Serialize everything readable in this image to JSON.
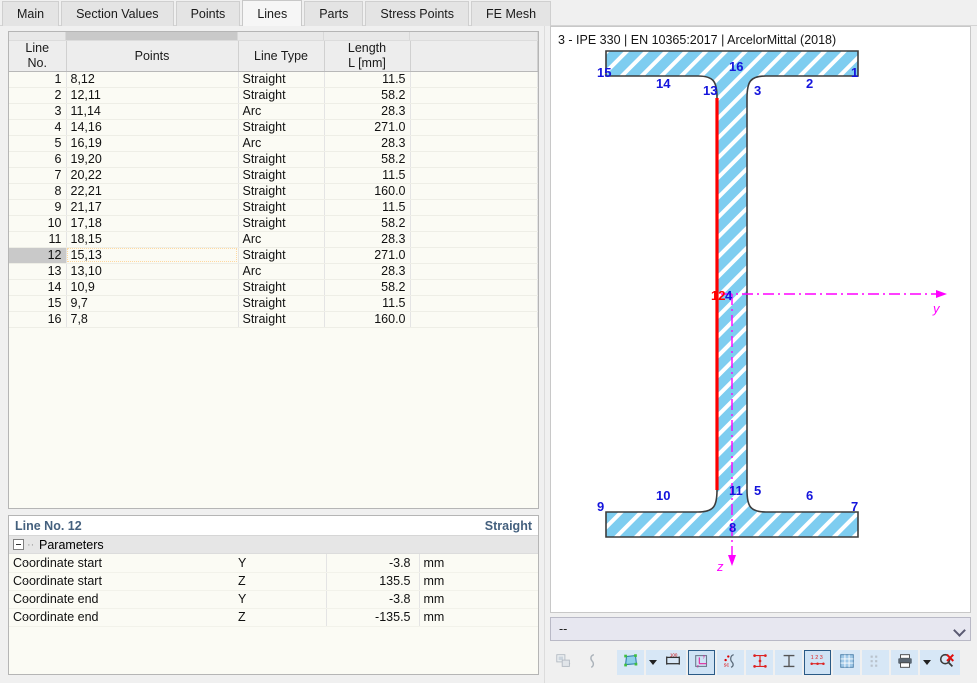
{
  "tabs": [
    {
      "label": "Main",
      "active": false
    },
    {
      "label": "Section Values",
      "active": false
    },
    {
      "label": "Points",
      "active": false
    },
    {
      "label": "Lines",
      "active": true
    },
    {
      "label": "Parts",
      "active": false
    },
    {
      "label": "Stress Points",
      "active": false
    },
    {
      "label": "FE Mesh",
      "active": false
    }
  ],
  "table": {
    "headers": {
      "line_no": "Line\nNo.",
      "line_no_l1": "Line",
      "line_no_l2": "No.",
      "points": "Points",
      "line_type": "Line Type",
      "length_l1": "Length",
      "length_l2": "L [mm]",
      "blank": ""
    },
    "rows": [
      {
        "no": "1",
        "points": "8,12",
        "type": "Straight",
        "length": "11.5",
        "selected": false
      },
      {
        "no": "2",
        "points": "12,11",
        "type": "Straight",
        "length": "58.2",
        "selected": false
      },
      {
        "no": "3",
        "points": "11,14",
        "type": "Arc",
        "length": "28.3",
        "selected": false
      },
      {
        "no": "4",
        "points": "14,16",
        "type": "Straight",
        "length": "271.0",
        "selected": false
      },
      {
        "no": "5",
        "points": "16,19",
        "type": "Arc",
        "length": "28.3",
        "selected": false
      },
      {
        "no": "6",
        "points": "19,20",
        "type": "Straight",
        "length": "58.2",
        "selected": false
      },
      {
        "no": "7",
        "points": "20,22",
        "type": "Straight",
        "length": "11.5",
        "selected": false
      },
      {
        "no": "8",
        "points": "22,21",
        "type": "Straight",
        "length": "160.0",
        "selected": false
      },
      {
        "no": "9",
        "points": "21,17",
        "type": "Straight",
        "length": "11.5",
        "selected": false
      },
      {
        "no": "10",
        "points": "17,18",
        "type": "Straight",
        "length": "58.2",
        "selected": false
      },
      {
        "no": "11",
        "points": "18,15",
        "type": "Arc",
        "length": "28.3",
        "selected": false
      },
      {
        "no": "12",
        "points": "15,13",
        "type": "Straight",
        "length": "271.0",
        "selected": true
      },
      {
        "no": "13",
        "points": "13,10",
        "type": "Arc",
        "length": "28.3",
        "selected": false
      },
      {
        "no": "14",
        "points": "10,9",
        "type": "Straight",
        "length": "58.2",
        "selected": false
      },
      {
        "no": "15",
        "points": "9,7",
        "type": "Straight",
        "length": "11.5",
        "selected": false
      },
      {
        "no": "16",
        "points": "7,8",
        "type": "Straight",
        "length": "160.0",
        "selected": false
      }
    ]
  },
  "parameters": {
    "header_left": "Line No. 12",
    "header_right": "Straight",
    "group_label": "Parameters",
    "rows": [
      {
        "name": "Coordinate start",
        "axis": "Y",
        "value": "-3.8",
        "unit": "mm"
      },
      {
        "name": "Coordinate start",
        "axis": "Z",
        "value": "135.5",
        "unit": "mm"
      },
      {
        "name": "Coordinate end",
        "axis": "Y",
        "value": "-3.8",
        "unit": "mm"
      },
      {
        "name": "Coordinate end",
        "axis": "Z",
        "value": "-135.5",
        "unit": "mm"
      }
    ]
  },
  "viewer": {
    "title": "3 - IPE 330 | EN 10365:2017 | ArcelorMittal (2018)",
    "point_labels": [
      "1",
      "2",
      "3",
      "5",
      "6",
      "7",
      "8",
      "9",
      "10",
      "11",
      "13",
      "14",
      "15",
      "16"
    ],
    "selected_line_label": "12",
    "centroid_label": "4",
    "axis_y_label": "y",
    "axis_z_label": "z",
    "colors": {
      "section_fill": "#7ecdf0",
      "section_outline": "#3c3c3c",
      "label_blue": "#1414dc",
      "selected_red": "#ff0000",
      "axis_magenta": "#ff00ff"
    },
    "combo_value": "--",
    "toolbar": [
      {
        "name": "import-section-button",
        "icon": "import",
        "state": "disabled"
      },
      {
        "name": "section-outline-button",
        "icon": "outline",
        "state": "disabled"
      },
      {
        "name": "show-parts-button",
        "icon": "part",
        "state": "lite"
      },
      {
        "name": "show-parts-dropdown",
        "icon": "caret",
        "state": "lite"
      },
      {
        "name": "show-dimensions-button",
        "icon": "dimension",
        "state": "lite"
      },
      {
        "name": "show-axes-button",
        "icon": "axes",
        "state": "pressed"
      },
      {
        "name": "show-stress-points-button",
        "icon": "sc",
        "state": "lite"
      },
      {
        "name": "show-nodes-button",
        "icon": "nodes",
        "state": "lite"
      },
      {
        "name": "show-section-button",
        "icon": "ibeam",
        "state": "lite"
      },
      {
        "name": "show-numbering-button",
        "icon": "numbers",
        "state": "pressed"
      },
      {
        "name": "show-mesh-button",
        "icon": "grid",
        "state": "lite"
      },
      {
        "name": "show-dots-button",
        "icon": "dots",
        "state": "lite"
      },
      {
        "name": "print-button",
        "icon": "printer",
        "state": "lite"
      },
      {
        "name": "print-dropdown",
        "icon": "caret",
        "state": "lite"
      },
      {
        "name": "zoom-reset-button",
        "icon": "zoomx",
        "state": "lite"
      }
    ]
  }
}
